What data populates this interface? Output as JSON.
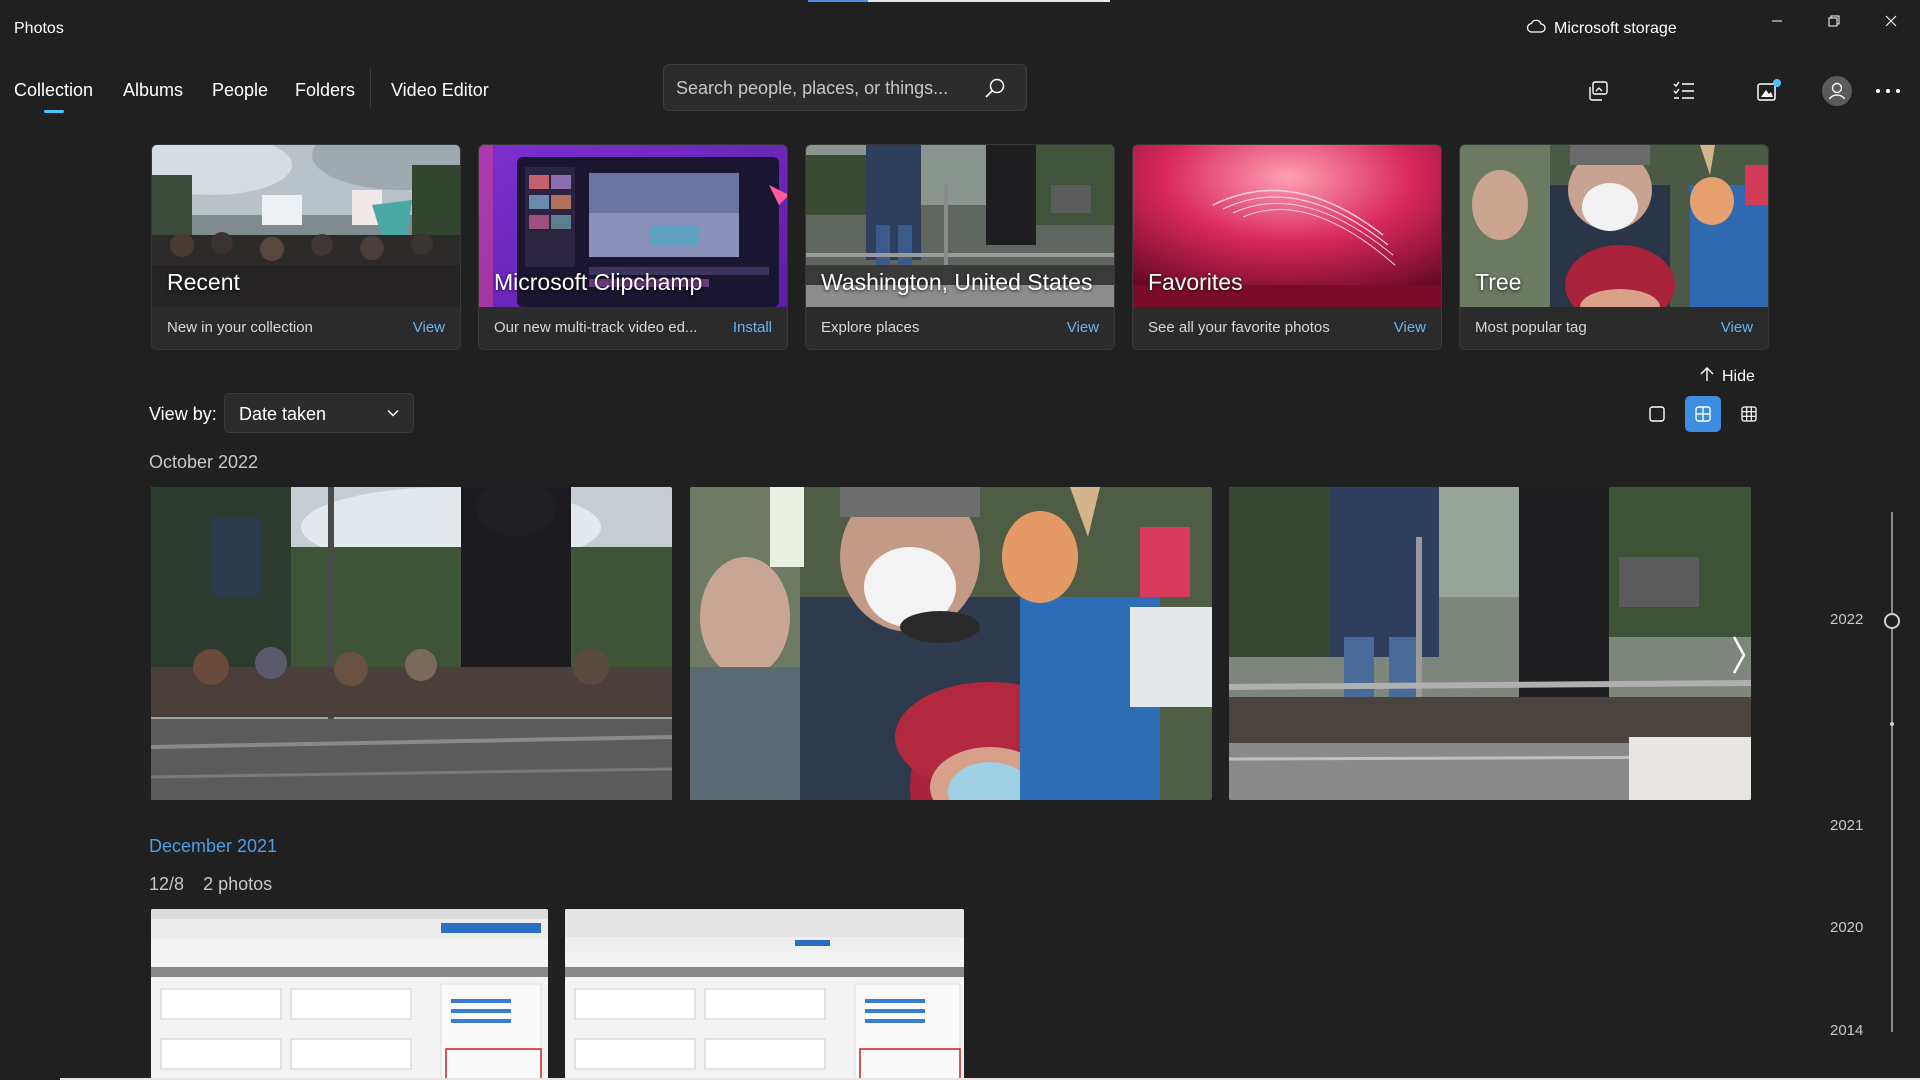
{
  "app": {
    "title": "Photos",
    "storage_label": "Microsoft storage",
    "window_controls": [
      "minimize-icon",
      "restore-icon",
      "close-icon"
    ]
  },
  "nav": {
    "tabs": [
      {
        "label": "Collection",
        "active": true
      },
      {
        "label": "Albums",
        "active": false
      },
      {
        "label": "People",
        "active": false
      },
      {
        "label": "Folders",
        "active": false
      },
      {
        "label": "Video Editor",
        "active": false
      }
    ]
  },
  "search": {
    "placeholder": "Search people, places, or things...",
    "value": ""
  },
  "toolbar_icons": [
    "import-icon",
    "select-checklist-icon",
    "notifications-icon",
    "account-icon",
    "more-icon"
  ],
  "cards": [
    {
      "title": "Recent",
      "subtitle": "New in your collection",
      "action": "View"
    },
    {
      "title": "Microsoft Clipchamp",
      "subtitle": "Our new multi-track video ed...",
      "action": "Install"
    },
    {
      "title": "Washington, United States",
      "subtitle": "Explore places",
      "action": "View"
    },
    {
      "title": "Favorites",
      "subtitle": "See all your favorite photos",
      "action": "View"
    },
    {
      "title": "Tree",
      "subtitle": "Most popular tag",
      "action": "View"
    }
  ],
  "hide_label": "Hide",
  "view_by": {
    "label": "View by:",
    "selected": "Date taken"
  },
  "view_modes": {
    "options": [
      "single-view-icon",
      "medium-grid-icon",
      "small-grid-icon"
    ],
    "selected": "medium-grid-icon"
  },
  "sections": [
    {
      "heading": "October 2022",
      "photo_count": 3
    },
    {
      "heading": "December 2021",
      "day": "12/8",
      "count_label": "2 photos",
      "photo_count": 2
    }
  ],
  "timeline": {
    "years": [
      "2022",
      "2021",
      "2020",
      "2014"
    ],
    "current": "2022"
  },
  "colors": {
    "background": "#202020",
    "accent": "#4cc2ff",
    "link": "#4e9de8",
    "selected_mode": "#3d8ee0"
  }
}
